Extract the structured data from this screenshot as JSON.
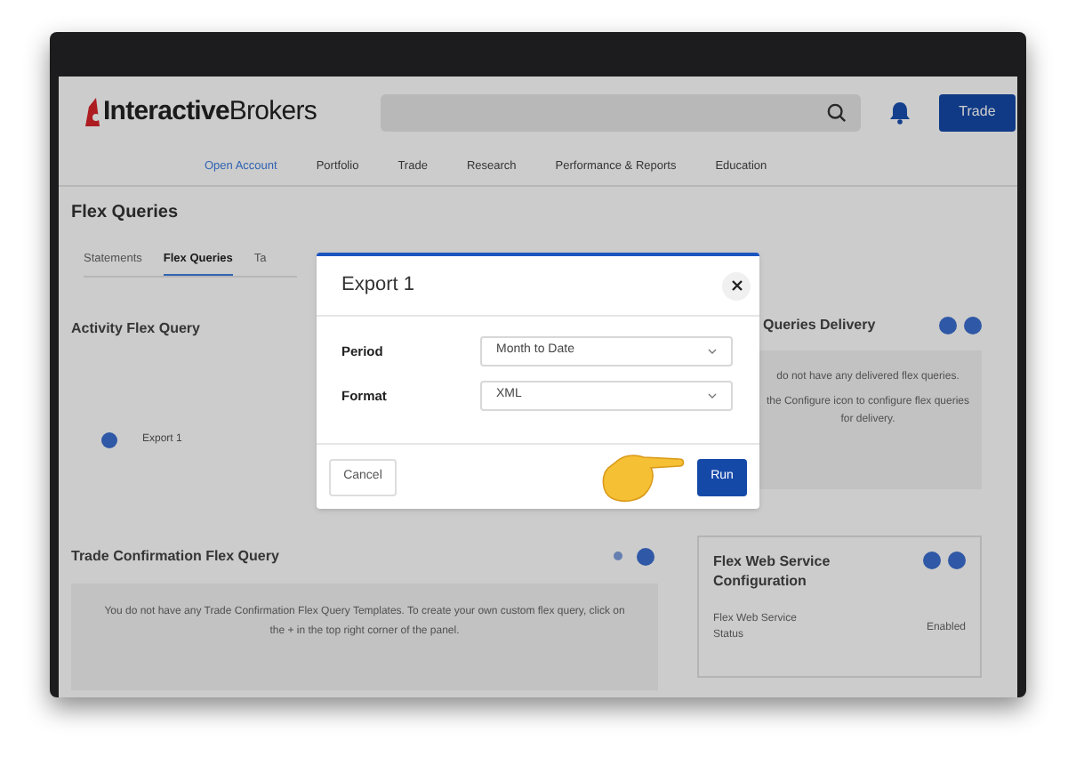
{
  "header": {
    "logo": {
      "bold": "Interactive",
      "light": "Brokers"
    },
    "trade_button": "Trade"
  },
  "nav": [
    {
      "label": "Open Account",
      "selected": true
    },
    {
      "label": "Portfolio",
      "selected": false
    },
    {
      "label": "Trade",
      "selected": false
    },
    {
      "label": "Research",
      "selected": false
    },
    {
      "label": "Performance & Reports",
      "selected": false
    },
    {
      "label": "Education",
      "selected": false
    }
  ],
  "page_title": "Flex Queries",
  "tabs": [
    {
      "label": "Statements",
      "selected": false
    },
    {
      "label": "Flex Queries",
      "selected": true
    },
    {
      "label": "Ta",
      "selected": false
    }
  ],
  "activity_panel": {
    "title": "Activity Flex Query",
    "queries": [
      {
        "label": "Export 1",
        "selected": true
      }
    ]
  },
  "trade_confirmation_panel": {
    "title": "Trade Confirmation Flex Query",
    "message": "You do not have any Trade Confirmation Flex Query Templates. To create your own custom flex query, click on the + in the top right corner of the panel."
  },
  "delivery_panel": {
    "title": "Queries Delivery",
    "message_lines": [
      "do not have any delivered flex queries.",
      "the Configure icon to configure flex queries for delivery."
    ]
  },
  "web_service_panel": {
    "title": "Flex Web Service Configuration",
    "rows": [
      {
        "label": "Flex Web Service Status",
        "value": "Enabled"
      }
    ]
  },
  "dialog": {
    "title": "Export 1",
    "fields": [
      {
        "label": "Period",
        "value": "Month to Date"
      },
      {
        "label": "Format",
        "value": "XML"
      }
    ],
    "cancel": "Cancel",
    "run": "Run"
  }
}
